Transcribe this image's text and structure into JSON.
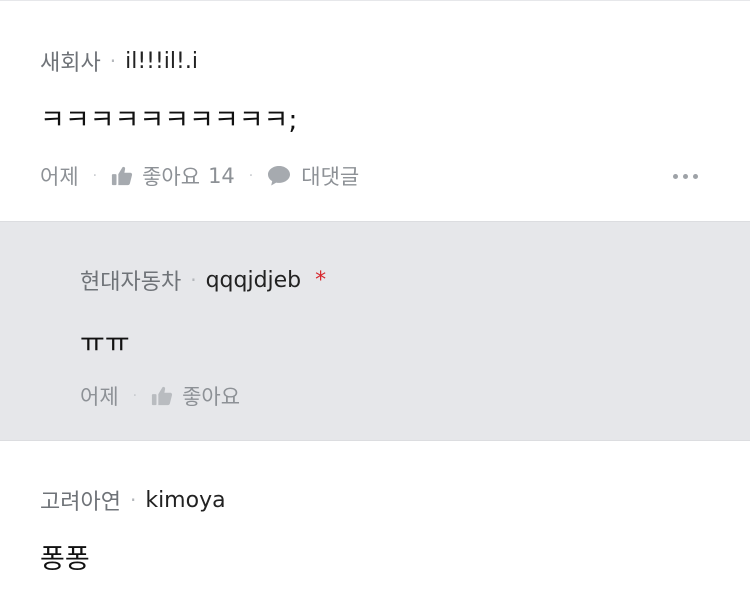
{
  "comments": [
    {
      "company": "새회사",
      "nickname": "il!!!il!.i",
      "text": "ㅋㅋㅋㅋㅋㅋㅋㅋㅋㅋ;",
      "time": "어제",
      "like_label": "좋아요",
      "like_count": "14",
      "reply_label": "대댓글"
    },
    {
      "company": "현대자동차",
      "nickname": "qqqjdjeb",
      "author_mark": "*",
      "text": "ㅠㅠ",
      "time": "어제",
      "like_label": "좋아요"
    },
    {
      "company": "고려아연",
      "nickname": "kimoya",
      "text": "퐁퐁"
    }
  ],
  "separators": {
    "meta": "·",
    "action": "·"
  },
  "icons": {
    "like": "thumbs-up-icon",
    "reply": "speech-bubble-icon",
    "more": "more-horizontal-icon"
  },
  "colors": {
    "reply_background": "#e6e7ea",
    "author_mark": "#d7262c",
    "secondary_text": "#8d9196"
  }
}
